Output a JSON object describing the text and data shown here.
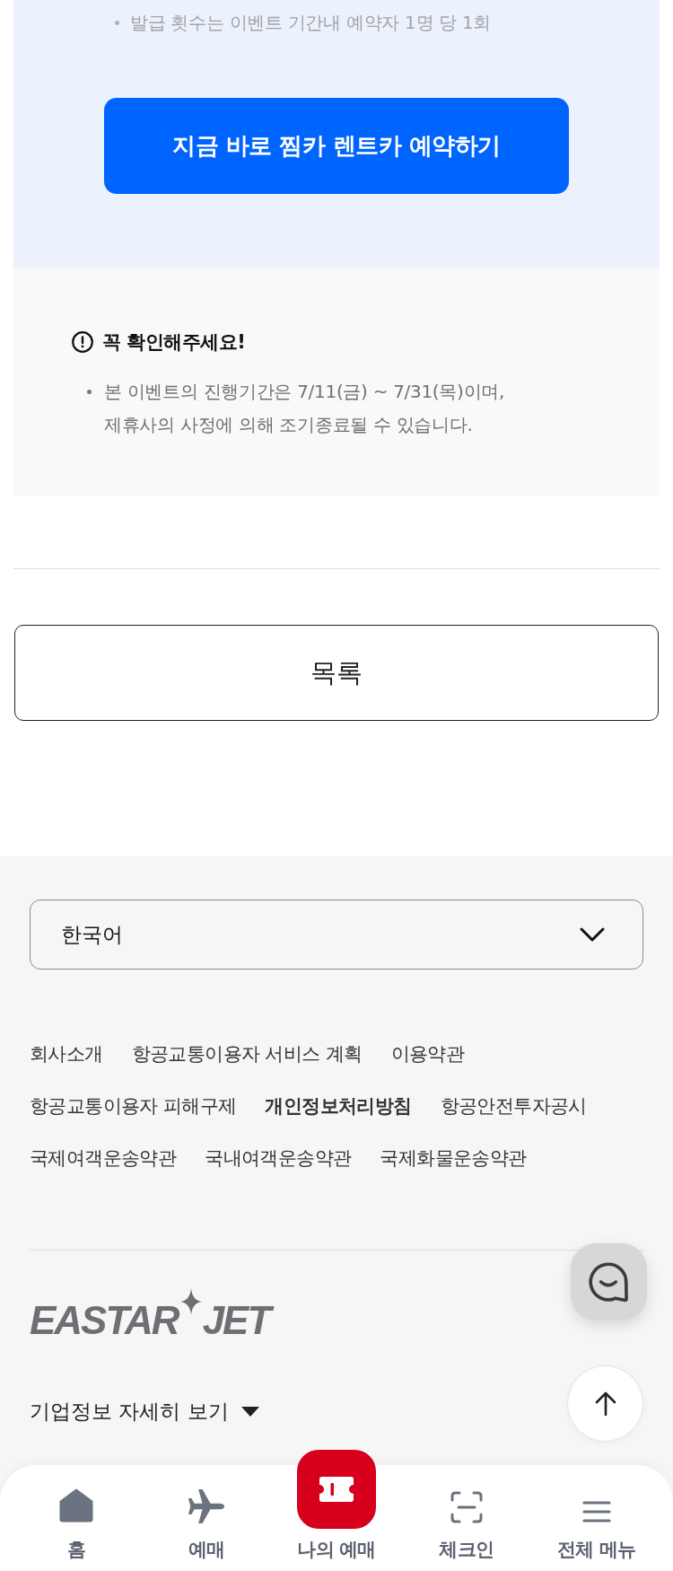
{
  "benefit_panel": {
    "bullets": [
      "발급 횟수는 이벤트 기간내 예약자 1명 당 1회"
    ],
    "cta_button": "지금 바로 찜카 렌트카 예약하기"
  },
  "notice": {
    "title": "꼭 확인해주세요!",
    "bullets": [
      "본 이벤트의 진행기간은 7/11(금) ~ 7/31(목)이며,\n제휴사의 사정에 의해 조기종료될 수 있습니다."
    ]
  },
  "list_button": "목록",
  "footer": {
    "language_select": {
      "value": "한국어"
    },
    "link_rows": [
      {
        "links": [
          {
            "label": "회사소개",
            "highlighted": false
          },
          {
            "label": "항공교통이용자 서비스 계획",
            "highlighted": false
          },
          {
            "label": "이용약관",
            "highlighted": false
          }
        ]
      },
      {
        "links": [
          {
            "label": "항공교통이용자 피해구제",
            "highlighted": false
          },
          {
            "label": "개인정보처리방침",
            "highlighted": true
          },
          {
            "label": "항공안전투자공시",
            "highlighted": false
          }
        ]
      },
      {
        "links": [
          {
            "label": "국제여객운송약관",
            "highlighted": false
          },
          {
            "label": "국내여객운송약관",
            "highlighted": false
          },
          {
            "label": "국제화물운송약관",
            "highlighted": false
          }
        ]
      }
    ],
    "logo": {
      "words": [
        "EASTAR",
        "JET"
      ]
    },
    "company_info_toggle": {
      "label": "기업정보 자세히 보기",
      "expanded": false
    }
  },
  "bottom_nav": [
    {
      "label": "홈",
      "kind": "home",
      "featured": false
    },
    {
      "label": "예매",
      "kind": "flight",
      "featured": false
    },
    {
      "label": "나의 예매",
      "kind": "ticket",
      "featured": true
    },
    {
      "label": "체크인",
      "kind": "scan",
      "featured": false
    },
    {
      "label": "전체 메뉴",
      "kind": "menu",
      "featured": false
    }
  ]
}
